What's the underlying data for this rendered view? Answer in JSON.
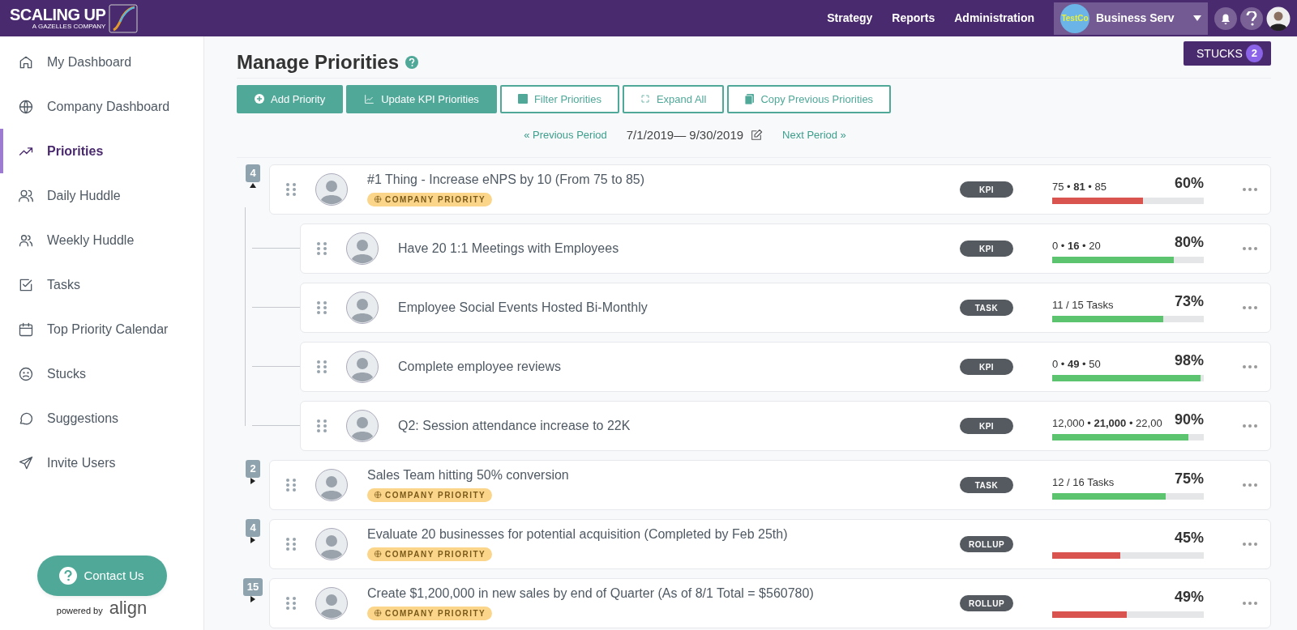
{
  "header": {
    "logo_title": "SCALING UP",
    "logo_subtitle": "A GAZELLES COMPANY",
    "nav": [
      "Strategy",
      "Reports",
      "Administration"
    ],
    "company": {
      "logo_text": "TestCo",
      "name": "Business Serv"
    }
  },
  "sidebar": {
    "items": [
      {
        "label": "My Dashboard",
        "selected": false
      },
      {
        "label": "Company Dashboard",
        "selected": false
      },
      {
        "label": "Priorities",
        "selected": true
      },
      {
        "label": "Daily Huddle",
        "selected": false
      },
      {
        "label": "Weekly Huddle",
        "selected": false
      },
      {
        "label": "Tasks",
        "selected": false
      },
      {
        "label": "Top Priority Calendar",
        "selected": false
      },
      {
        "label": "Stucks",
        "selected": false
      },
      {
        "label": "Suggestions",
        "selected": false
      },
      {
        "label": "Invite Users",
        "selected": false
      }
    ],
    "contact": "Contact Us",
    "powered_by": "powered by",
    "brand": "align"
  },
  "page": {
    "title": "Manage Priorities",
    "stucks": {
      "label": "STUCKS",
      "count": "2"
    },
    "actions": [
      {
        "label": "Add Priority",
        "kind": "solid"
      },
      {
        "label": "Update KPI Priorities",
        "kind": "solid"
      },
      {
        "label": "Filter Priorities",
        "kind": "outline"
      },
      {
        "label": "Expand All",
        "kind": "outline"
      },
      {
        "label": "Copy Previous Priorities",
        "kind": "outline"
      }
    ],
    "period": {
      "previous": "« Previous Period",
      "range": "7/1/2019— 9/30/2019",
      "next": "Next Period »"
    }
  },
  "priorities": [
    {
      "count": "4",
      "expanded": true,
      "title": "#1 Thing - Increase eNPS by 10 (From 75 to 85)",
      "tag": "COMPANY PRIORITY",
      "type": "KPI",
      "reading": "75 • **81** • 85",
      "percent": "60%",
      "level": 0.6,
      "color": "#d9534f",
      "children": [
        {
          "title": "Have 20 1:1 Meetings with Employees",
          "type": "KPI",
          "reading": "0 • **16** • 20",
          "percent": "80%",
          "level": 0.8,
          "color": "#5cc36e"
        },
        {
          "title": "Employee Social Events Hosted Bi-Monthly",
          "type": "TASK",
          "reading": "11 / 15 Tasks",
          "percent": "73%",
          "level": 0.73,
          "color": "#5cc36e"
        },
        {
          "title": "Complete employee reviews",
          "type": "KPI",
          "reading": "0 • **49** • 50",
          "percent": "98%",
          "level": 0.98,
          "color": "#5cc36e"
        },
        {
          "title": "Q2: Session attendance increase to 22K",
          "type": "KPI",
          "reading": "12,000 • **21,000** • 22,00",
          "percent": "90%",
          "level": 0.9,
          "color": "#5cc36e"
        }
      ]
    },
    {
      "count": "2",
      "expanded": false,
      "title": "Sales Team hitting 50% conversion",
      "tag": "COMPANY PRIORITY",
      "type": "TASK",
      "reading": "12 / 16 Tasks",
      "percent": "75%",
      "level": 0.75,
      "color": "#5cc36e"
    },
    {
      "count": "4",
      "expanded": false,
      "title": "Evaluate 20 businesses for potential acquisition (Completed by Feb 25th)",
      "tag": "COMPANY PRIORITY",
      "type": "ROLLUP",
      "percent": "45%",
      "level": 0.45,
      "color": "#d9534f"
    },
    {
      "count": "15",
      "expanded": false,
      "title": "Create $1,200,000 in new sales by end of Quarter (As of 8/1 Total = $560780)",
      "tag": "COMPANY PRIORITY",
      "type": "ROLLUP",
      "percent": "49%",
      "level": 0.49,
      "color": "#d9534f"
    }
  ]
}
